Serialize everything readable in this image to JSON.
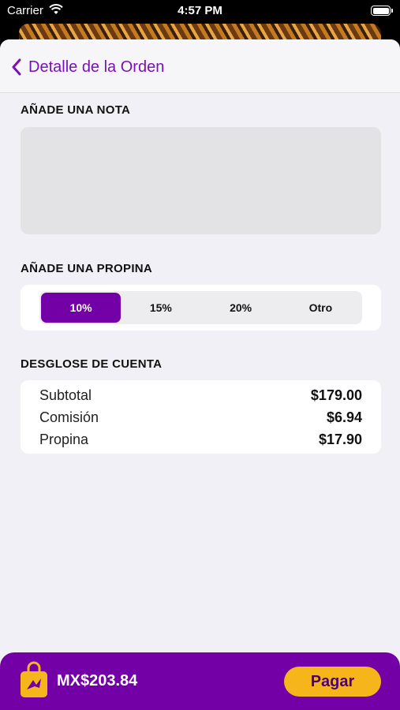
{
  "status_bar": {
    "carrier": "Carrier",
    "time": "4:57 PM"
  },
  "nav": {
    "back_label": "Detalle de la Orden"
  },
  "note": {
    "title": "AÑADE UNA NOTA",
    "placeholder": ""
  },
  "tip": {
    "title": "AÑADE UNA PROPINA",
    "options": [
      "10%",
      "15%",
      "20%",
      "Otro"
    ],
    "selected": "10%"
  },
  "breakdown": {
    "title": "DESGLOSE DE CUENTA",
    "rows": [
      {
        "label": "Subtotal",
        "value": "$179.00"
      },
      {
        "label": "Comisión",
        "value": "$6.94"
      },
      {
        "label": "Propina",
        "value": "$17.90"
      }
    ]
  },
  "footer": {
    "total": "MX$203.84",
    "pay_label": "Pagar"
  },
  "colors": {
    "accent": "#7200a6",
    "pay_button": "#f7b51c",
    "link": "#7a11b6"
  },
  "icons": {
    "back": "chevron-left-icon",
    "bag": "shopping-bag-icon",
    "wifi": "wifi-icon",
    "battery": "battery-icon"
  }
}
